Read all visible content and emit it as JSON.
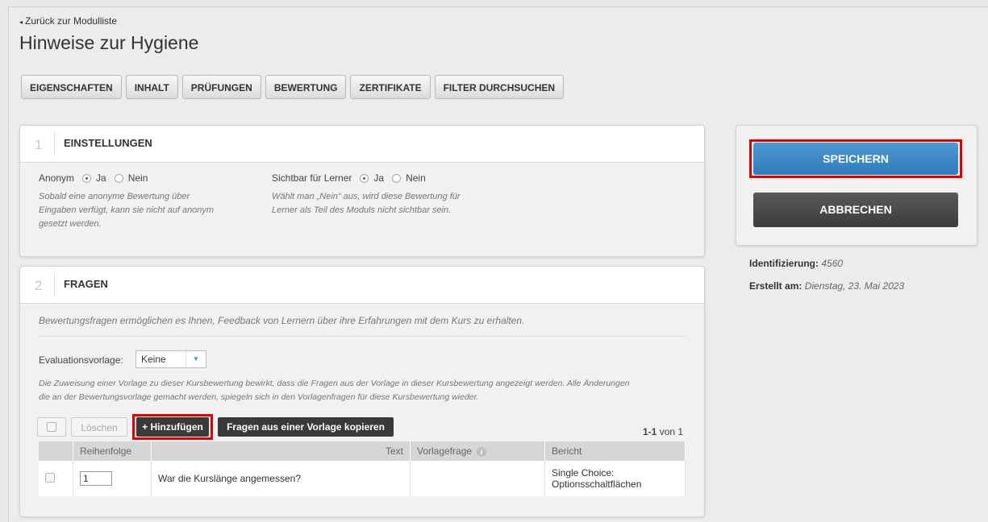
{
  "nav": {
    "back_label": "Zurück zur Modulliste"
  },
  "page": {
    "title": "Hinweise zur Hygiene"
  },
  "tabs": [
    "EIGENSCHAFTEN",
    "INHALT",
    "PRÜFUNGEN",
    "BEWERTUNG",
    "ZERTIFIKATE",
    "FILTER DURCHSUCHEN"
  ],
  "settings": {
    "number": "1",
    "title": "EINSTELLUNGEN",
    "anonym_label": "Anonym",
    "sichtbar_label": "Sichtbar für Lerner",
    "yes": "Ja",
    "no": "Nein",
    "anonym_selected": "Ja",
    "sichtbar_selected": "Ja",
    "anonym_hint": [
      "Sobald eine anonyme Bewertung über",
      "Eingaben verfügt, kann sie nicht auf anonym",
      "gesetzt werden."
    ],
    "sichtbar_hint": [
      "Wählt man „Nein“ aus, wird diese Bewertung für",
      "Lerner als Teil des Moduls nicht sichtbar sein."
    ]
  },
  "questions": {
    "number": "2",
    "title": "FRAGEN",
    "intro": "Bewertungsfragen ermöglichen es Ihnen, Feedback von Lernern über ihre Erfahrungen mit dem Kurs zu erhalten.",
    "template_label": "Evaluationsvorlage:",
    "template_value": "Keine",
    "template_hint": [
      "Die Zuweisung einer Vorlage zu dieser Kursbewertung bewirkt, dass die Fragen aus der Vorlage in dieser Kursbewertung angezeigt werden. Alle Änderungen",
      "die an der Bewertungsvorlage gemacht werden, spiegeln sich in den Vorlagenfragen für diese Kursbewertung wieder."
    ],
    "delete_label": "Löschen",
    "add_label": "+ Hinzufügen",
    "copy_label": "Fragen aus einer Vorlage kopieren",
    "pager_range": "1-1",
    "pager_total": "von 1",
    "columns": [
      "Reihenfolge",
      "Text",
      "Vorlagefrage",
      "Bericht"
    ],
    "rows": [
      {
        "order": "1",
        "text": "War die Kurslänge angemessen?",
        "template": "",
        "report": [
          "Single Choice:",
          "Optionsschaltflächen"
        ]
      }
    ]
  },
  "actions": {
    "save_label": "SPEICHERN",
    "cancel_label": "ABBRECHEN"
  },
  "meta": {
    "id_label": "Identifizierung:",
    "id_value": "4560",
    "created_label": "Erstellt am:",
    "created_value": "Dienstag, 23. Mai 2023"
  },
  "colors": {
    "save": "#3d8bc6",
    "cancel": "#4a4a4a",
    "highlight": "#e00000",
    "add_button": "#3a3a3a"
  }
}
